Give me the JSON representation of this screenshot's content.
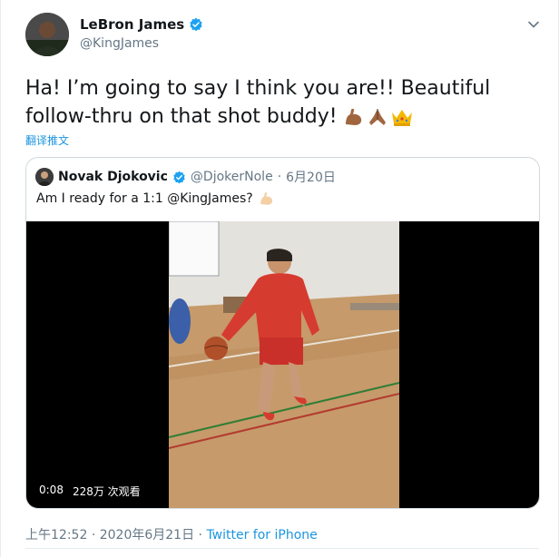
{
  "author": {
    "name": "LeBron James",
    "handle": "@KingJames"
  },
  "tweet": {
    "text": "Ha! I’m going to say I think you are!! Beautiful follow-thru on that shot buddy!",
    "emojis": [
      "flexed-biceps",
      "folded-hands",
      "crown"
    ],
    "translate_label": "翻译推文"
  },
  "quoted": {
    "name": "Novak Djokovic",
    "handle": "@DjokerNole",
    "separator": "·",
    "date": "6月20日",
    "text": "Am I ready for a 1:1 @KingJames?",
    "video": {
      "duration": "0:08",
      "views": "228万 次观看"
    }
  },
  "footer": {
    "time": "上午12:52",
    "separator": "·",
    "date": "2020年6月21日",
    "separator2": "·",
    "source": "Twitter for iPhone"
  },
  "colors": {
    "link": "#1b95e0",
    "muted": "#657786",
    "verified": "#1da1f2"
  }
}
